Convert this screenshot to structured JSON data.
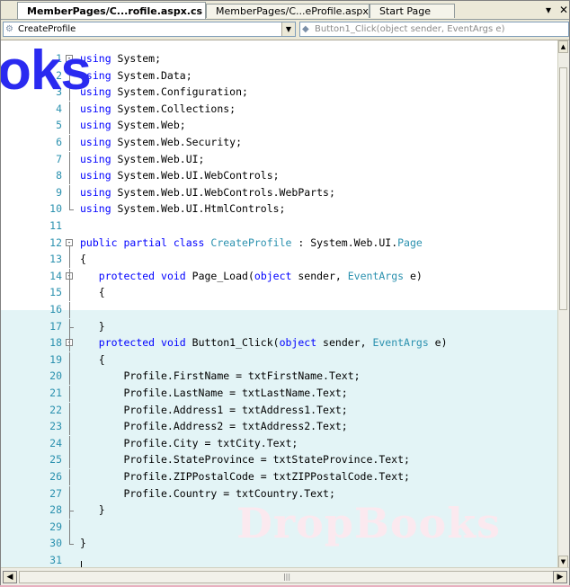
{
  "tabs": [
    {
      "label": "MemberPages/C...rofile.aspx.cs",
      "active": true
    },
    {
      "label": "MemberPages/C...eProfile.aspx",
      "active": false
    },
    {
      "label": "Start Page",
      "active": false
    }
  ],
  "tab_controls": {
    "dropdown": "▾",
    "close": "✕"
  },
  "navbar": {
    "class_combo": "CreateProfile",
    "method_combo": "Button1_Click(object sender, EventArgs e)"
  },
  "logo_text": "oks",
  "watermark_text": "DropBooks",
  "code_lines": [
    {
      "n": "1",
      "fold": "minus",
      "bar": "start",
      "parts": [
        [
          "kw",
          "using"
        ],
        [
          "",
          "  System;"
        ]
      ]
    },
    {
      "n": "2",
      "fold": "",
      "bar": "mid",
      "parts": [
        [
          "kw",
          "using"
        ],
        [
          "",
          "  System.Data;"
        ]
      ]
    },
    {
      "n": "3",
      "fold": "",
      "bar": "mid",
      "parts": [
        [
          "kw",
          "using"
        ],
        [
          "",
          "  System.Configuration;"
        ]
      ]
    },
    {
      "n": "4",
      "fold": "",
      "bar": "mid",
      "parts": [
        [
          "kw",
          "using"
        ],
        [
          "",
          "  System.Collections;"
        ]
      ]
    },
    {
      "n": "5",
      "fold": "",
      "bar": "mid",
      "parts": [
        [
          "kw",
          "using"
        ],
        [
          "",
          "  System.Web;"
        ]
      ]
    },
    {
      "n": "6",
      "fold": "",
      "bar": "mid",
      "parts": [
        [
          "kw",
          "using"
        ],
        [
          "",
          "  System.Web.Security;"
        ]
      ]
    },
    {
      "n": "7",
      "fold": "",
      "bar": "mid",
      "parts": [
        [
          "kw",
          "using"
        ],
        [
          "",
          "  System.Web.UI;"
        ]
      ]
    },
    {
      "n": "8",
      "fold": "",
      "bar": "mid",
      "parts": [
        [
          "kw",
          "using"
        ],
        [
          "",
          "  System.Web.UI.WebControls;"
        ]
      ]
    },
    {
      "n": "9",
      "fold": "",
      "bar": "mid",
      "parts": [
        [
          "kw",
          "using"
        ],
        [
          "",
          "  System.Web.UI.WebControls.WebParts;"
        ]
      ]
    },
    {
      "n": "10",
      "fold": "",
      "bar": "end",
      "parts": [
        [
          "kw",
          "using"
        ],
        [
          "",
          "  System.Web.UI.HtmlControls;"
        ]
      ]
    },
    {
      "n": "11",
      "fold": "",
      "bar": "",
      "parts": []
    },
    {
      "n": "12",
      "fold": "minus",
      "bar": "start",
      "parts": [
        [
          "kw",
          "public partial class"
        ],
        [
          "ty",
          "  CreateProfile"
        ],
        [
          "",
          " : System.Web.UI."
        ],
        [
          "ty",
          "Page"
        ]
      ]
    },
    {
      "n": "13",
      "fold": "",
      "bar": "mid",
      "parts": [
        [
          "",
          "{"
        ]
      ]
    },
    {
      "n": "14",
      "fold": "minus",
      "bar": "mid",
      "parts": [
        [
          "",
          "    "
        ],
        [
          "kw",
          "protected void"
        ],
        [
          "",
          " Page_Load("
        ],
        [
          "kw",
          "object"
        ],
        [
          "",
          " sender, "
        ],
        [
          "ty",
          "EventArgs"
        ],
        [
          "",
          " e)"
        ]
      ]
    },
    {
      "n": "15",
      "fold": "",
      "bar": "mid",
      "parts": [
        [
          "",
          "    {"
        ]
      ]
    },
    {
      "n": "16",
      "fold": "",
      "bar": "mid",
      "parts": []
    },
    {
      "n": "17",
      "fold": "",
      "bar": "tick",
      "parts": [
        [
          "",
          "    }"
        ]
      ]
    },
    {
      "n": "18",
      "fold": "minus",
      "bar": "mid",
      "parts": [
        [
          "",
          "    "
        ],
        [
          "kw",
          "protected void"
        ],
        [
          "",
          " Button1_Click("
        ],
        [
          "kw",
          "object"
        ],
        [
          "",
          " sender, "
        ],
        [
          "ty",
          "EventArgs"
        ],
        [
          "",
          " e)"
        ]
      ]
    },
    {
      "n": "19",
      "fold": "",
      "bar": "mid",
      "parts": [
        [
          "",
          "    {"
        ]
      ]
    },
    {
      "n": "20",
      "fold": "",
      "bar": "mid",
      "parts": [
        [
          "",
          "        Profile.FirstName = txtFirstName.Text;"
        ]
      ]
    },
    {
      "n": "21",
      "fold": "",
      "bar": "mid",
      "parts": [
        [
          "",
          "        Profile.LastName = txtLastName.Text;"
        ]
      ]
    },
    {
      "n": "22",
      "fold": "",
      "bar": "mid",
      "parts": [
        [
          "",
          "        Profile.Address1 = txtAddress1.Text;"
        ]
      ]
    },
    {
      "n": "23",
      "fold": "",
      "bar": "mid",
      "parts": [
        [
          "",
          "        Profile.Address2 = txtAddress2.Text;"
        ]
      ]
    },
    {
      "n": "24",
      "fold": "",
      "bar": "mid",
      "parts": [
        [
          "",
          "        Profile.City = txtCity.Text;"
        ]
      ]
    },
    {
      "n": "25",
      "fold": "",
      "bar": "mid",
      "parts": [
        [
          "",
          "        Profile.StateProvince = txtStateProvince.Text;"
        ]
      ]
    },
    {
      "n": "26",
      "fold": "",
      "bar": "mid",
      "parts": [
        [
          "",
          "        Profile.ZIPPostalCode = txtZIPPostalCode.Text;"
        ]
      ]
    },
    {
      "n": "27",
      "fold": "",
      "bar": "mid",
      "parts": [
        [
          "",
          "        Profile.Country = txtCountry.Text;"
        ]
      ]
    },
    {
      "n": "28",
      "fold": "",
      "bar": "tick",
      "parts": [
        [
          "",
          "    }"
        ]
      ]
    },
    {
      "n": "29",
      "fold": "",
      "bar": "mid",
      "parts": []
    },
    {
      "n": "30",
      "fold": "",
      "bar": "end",
      "parts": [
        [
          "",
          "}"
        ]
      ]
    },
    {
      "n": "31",
      "fold": "",
      "bar": "",
      "parts": []
    }
  ],
  "hscroll_thumb_glyph": "|||",
  "icons": {
    "class_icon": "class-icon",
    "method_icon": "method-icon"
  }
}
